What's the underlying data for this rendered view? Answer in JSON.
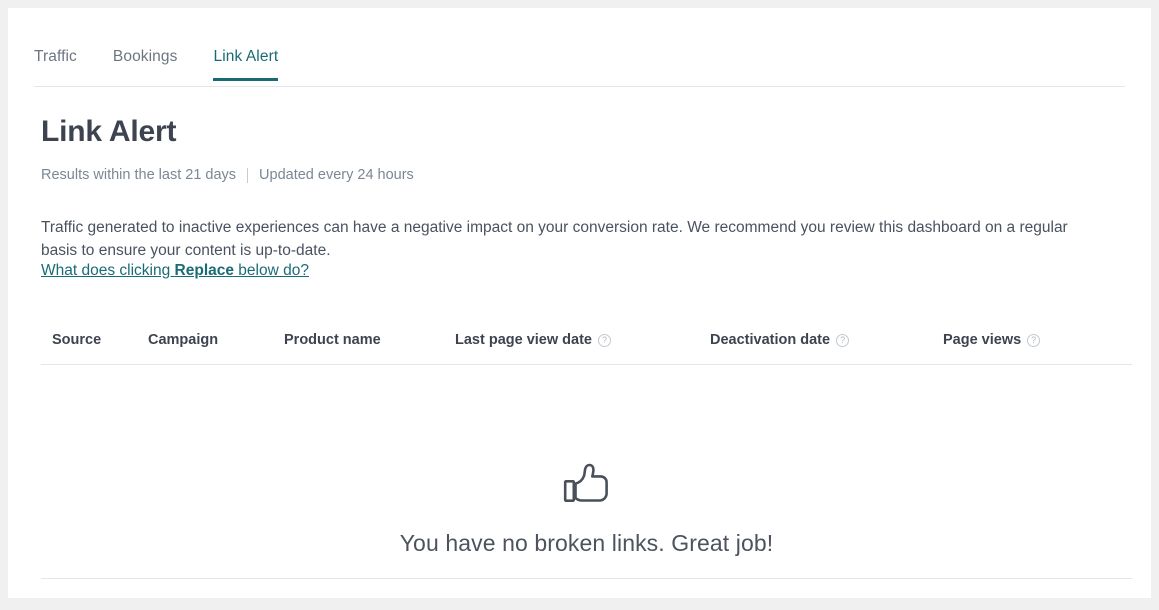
{
  "tabs": [
    {
      "label": "Traffic",
      "active": false
    },
    {
      "label": "Bookings",
      "active": false
    },
    {
      "label": "Link Alert",
      "active": true
    }
  ],
  "header": {
    "title": "Link Alert",
    "results_range": "Results within the last 21 days",
    "update_frequency": "Updated every 24 hours",
    "intro": "Traffic generated to inactive experiences can have a negative impact on your conversion rate. We recommend you review this dashboard on a regular basis to ensure your content is up-to-date.",
    "help_link_prefix": "What does clicking ",
    "help_link_bold": "Replace",
    "help_link_suffix": " below do?"
  },
  "table": {
    "columns": [
      {
        "label": "Source",
        "help": false
      },
      {
        "label": "Campaign",
        "help": false
      },
      {
        "label": "Product name",
        "help": false
      },
      {
        "label": "Last page view date",
        "help": true
      },
      {
        "label": "Deactivation date",
        "help": true
      },
      {
        "label": "Page views",
        "help": true
      }
    ],
    "help_icon": "question-circle-icon",
    "help_icon_glyph": "?",
    "rows": []
  },
  "empty_state": {
    "icon": "thumbs-up-icon",
    "message": "You have no broken links. Great job!"
  },
  "colors": {
    "accent": "#186a75",
    "page_background": "#f0f0f0",
    "card_background": "#ffffff",
    "heading_text": "#3d4450",
    "muted_text": "#7b8794",
    "divider": "#e4e6e8"
  }
}
